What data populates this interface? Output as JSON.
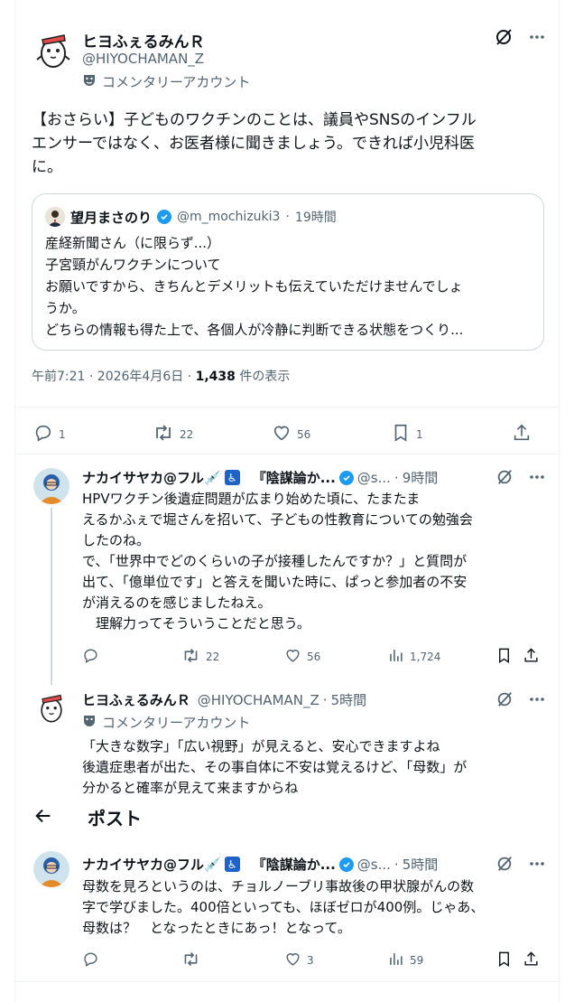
{
  "main_post": {
    "author_name": "ヒヨふぇるみんＲ",
    "author_handle": "@HIYOCHAMAN_Z",
    "account_label": "コメンタリーアカウント",
    "text_lines": [
      "【おさらい】子どものワクチンのことは、議員やSNSのインフル",
      "エンサーではなく、お医者様に聞きましょう。できれば小児科医",
      "に。"
    ],
    "quote": {
      "author_name": "望月まさのり",
      "author_handle": "@m_mochizuki3",
      "time": "19時間",
      "lines": [
        "産経新聞さん（に限らず...）",
        "子宮頸がんワクチンについて",
        "お願いですから、きちんとデメリットも伝えていただけませんでしょ",
        "うか。",
        "どちらの情報も得た上で、各個人が冷静に判断できる状態をつくり..."
      ]
    },
    "meta": {
      "datetime": "午前7:21 · 2026年4月6日 · ",
      "views_count": "1,438",
      "views_label": " 件の表示"
    },
    "stats": {
      "replies": "1",
      "reposts": "22",
      "likes": "56",
      "bookmarks": "1"
    }
  },
  "replies": [
    {
      "author_name": "ナカイサヤカ@フル💉",
      "author_suffix": "『陰謀論か...",
      "author_handle": "@s...",
      "time": "9時間",
      "lines": [
        "HPVワクチン後遺症問題が広まり始めた頃に、たまたま",
        "えるかふぇで堀さんを招いて、子どもの性教育についての勉強会",
        "したのね。",
        "で、「世界中でどのくらいの子が接種したんですか？」と質問が",
        "出て、「億単位です」と答えを聞いた時に、ぱっと参加者の不安",
        "が消えるのを感じましたねえ。",
        "　理解力ってそういうことだと思う。"
      ],
      "stats": {
        "replies": "",
        "reposts": "22",
        "likes": "56",
        "views": "1,724"
      }
    },
    {
      "author_name": "ヒヨふぇるみんＲ",
      "author_handle": "@HIYOCHAMAN_Z",
      "time": "5時間",
      "account_label": "コメンタリーアカウント",
      "lines": [
        "「大きな数字」「広い視野」が見えると、安心できますよね",
        "後遺症患者が出た、その事自体に不安は覚えるけど、「母数」が",
        "分かると確率が見えて来ますからね"
      ]
    },
    {
      "author_name": "ナカイサヤカ@フル💉",
      "author_suffix": "『陰謀論か...",
      "author_handle": "@s...",
      "time": "5時間",
      "lines": [
        "母数を見ろというのは、チョルノーブリ事故後の甲状腺がんの数",
        "字で学びました。400倍といっても、ほぼゼロが400例。じゃあ、",
        "母数は？　となったときにあっ！となって。"
      ],
      "stats": {
        "replies": "",
        "reposts": "",
        "likes": "3",
        "views": "59"
      }
    }
  ],
  "header": {
    "title": "ポスト"
  }
}
